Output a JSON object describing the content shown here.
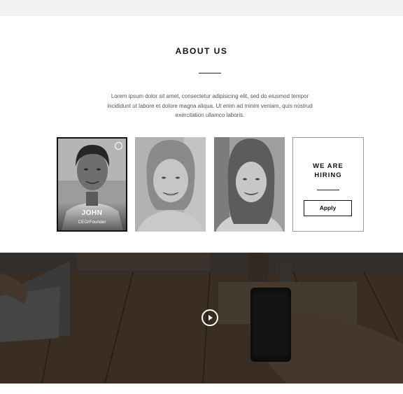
{
  "about": {
    "title": "ABOUT US",
    "intro": "Lorem ipsum dolor sit amet, consectetur adipisicing elit, sed do eiusmod tempor incididunt ut labore et dolore magna aliqua. Ut enim ad minim veniam, quis nostrud exercitation ullamco laboris."
  },
  "team": [
    {
      "name": "JOHN",
      "role": "CEO/Founder",
      "icon": "link-icon"
    }
  ],
  "hiring": {
    "title_line1": "WE ARE",
    "title_line2": "HIRING",
    "button_label": "Apply"
  },
  "video": {
    "icon": "play-icon"
  },
  "colors": {
    "topbar": "#f2f2f2",
    "text_dark": "#111111",
    "text_body": "#555555",
    "card_border": "#999999",
    "video_overlay": "#2b2b2b"
  }
}
